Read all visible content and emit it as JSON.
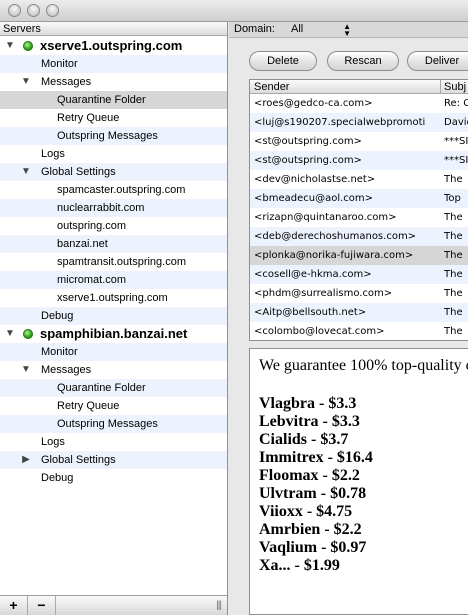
{
  "left_pane": {
    "header": "Servers",
    "tree": [
      {
        "label": "xserve1.outspring.com",
        "level": 0,
        "kind": "server",
        "expanded": true,
        "status": "online"
      },
      {
        "label": "Monitor",
        "level": 1
      },
      {
        "label": "Messages",
        "level": 1,
        "expanded": true
      },
      {
        "label": "Quarantine Folder",
        "level": 2,
        "selected": true
      },
      {
        "label": "Retry Queue",
        "level": 2
      },
      {
        "label": "Outspring Messages",
        "level": 2
      },
      {
        "label": "Logs",
        "level": 1
      },
      {
        "label": "Global Settings",
        "level": 1,
        "expanded": true
      },
      {
        "label": "spamcaster.outspring.com",
        "level": 2
      },
      {
        "label": "nuclearrabbit.com",
        "level": 2
      },
      {
        "label": "outspring.com",
        "level": 2
      },
      {
        "label": "banzai.net",
        "level": 2
      },
      {
        "label": "spamtransit.outspring.com",
        "level": 2
      },
      {
        "label": "micromat.com",
        "level": 2
      },
      {
        "label": "xserve1.outspring.com",
        "level": 2
      },
      {
        "label": "Debug",
        "level": 1
      },
      {
        "label": "spamphibian.banzai.net",
        "level": 0,
        "kind": "server",
        "expanded": true,
        "status": "online"
      },
      {
        "label": "Monitor",
        "level": 1
      },
      {
        "label": "Messages",
        "level": 1,
        "expanded": true
      },
      {
        "label": "Quarantine Folder",
        "level": 2
      },
      {
        "label": "Retry Queue",
        "level": 2
      },
      {
        "label": "Outspring Messages",
        "level": 2
      },
      {
        "label": "Logs",
        "level": 1
      },
      {
        "label": "Global Settings",
        "level": 1,
        "expanded": false
      },
      {
        "label": "Debug",
        "level": 1
      }
    ],
    "bottom_bar": {
      "add_label": "+",
      "remove_label": "−"
    }
  },
  "domain_bar": {
    "label": "Domain:",
    "value": "All"
  },
  "toolbar": {
    "delete_label": "Delete",
    "rescan_label": "Rescan",
    "deliver_label": "Deliver"
  },
  "message_list": {
    "columns": [
      "Sender",
      "Subj"
    ],
    "rows": [
      {
        "sender": "<roes@gedco-ca.com>",
        "subject": "Re: C"
      },
      {
        "sender": "<luj@s190207.specialwebpromoti",
        "subject": "Davic"
      },
      {
        "sender": "<st@outspring.com>",
        "subject": "***SI"
      },
      {
        "sender": "<st@outspring.com>",
        "subject": "***SI"
      },
      {
        "sender": "<dev@nicholastse.net>",
        "subject": "The"
      },
      {
        "sender": "<bmeadecu@aol.com>",
        "subject": "Top"
      },
      {
        "sender": "<rizapn@quintanaroo.com>",
        "subject": "The"
      },
      {
        "sender": "<deb@derechoshumanos.com>",
        "subject": "The"
      },
      {
        "sender": "<plonka@norika-fujiwara.com>",
        "subject": "The",
        "selected": true
      },
      {
        "sender": "<cosell@e-hkma.com>",
        "subject": "The"
      },
      {
        "sender": "<phdm@surrealismo.com>",
        "subject": "The"
      },
      {
        "sender": "<Aitp@bellsouth.net>",
        "subject": "The"
      },
      {
        "sender": "<colombo@lovecat.com>",
        "subject": "The"
      }
    ]
  },
  "preview": {
    "intro": "We guarantee 100% top-quality c",
    "lines": [
      "Vlagbra - $3.3",
      "Lebvitra - $3.3",
      "Cialids - $3.7",
      "Immitrex - $16.4",
      "Floomax - $2.2",
      "Ulvtram - $0.78",
      "Viioxx - $4.75",
      "Amrbien - $2.2",
      "Vaqlium - $0.97",
      "Xa... - $1.99"
    ]
  }
}
